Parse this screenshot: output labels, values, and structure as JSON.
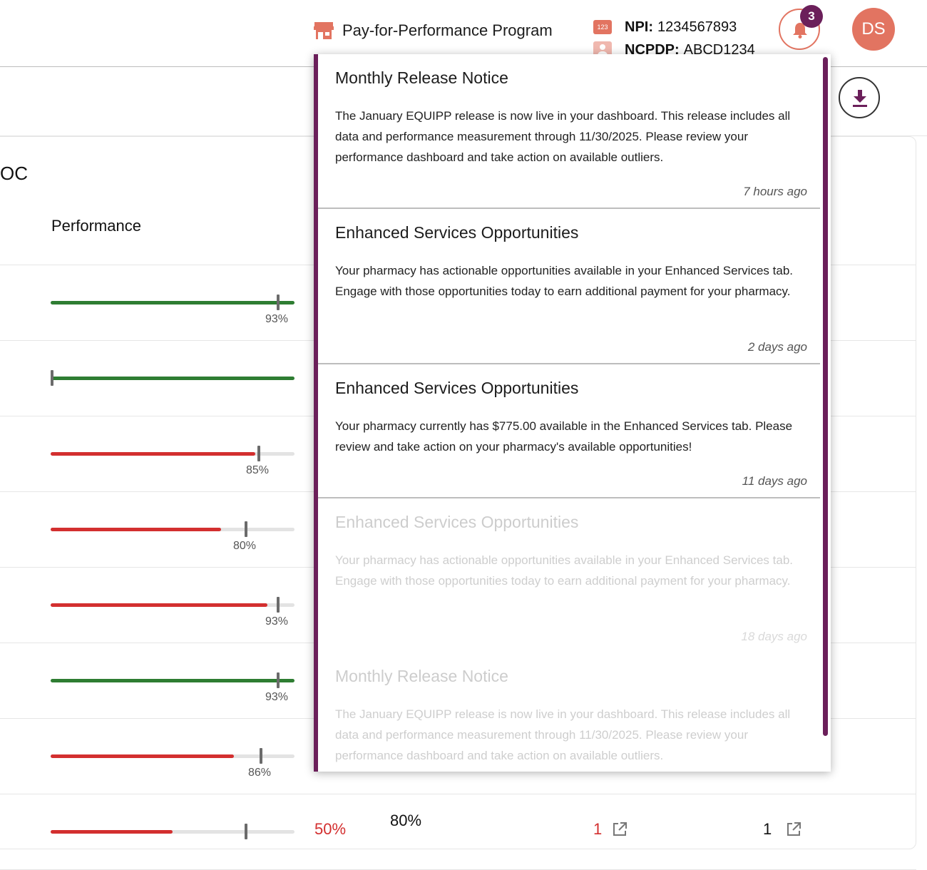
{
  "header": {
    "program_title": "Pay-for-Performance Program",
    "npi_label": "NPI:",
    "npi_value": "1234567893",
    "ncpdp_label": "NCPDP:",
    "ncpdp_value": "ABCD1234",
    "id_badge_text": "123",
    "notification_count": "3",
    "avatar_initials": "DS"
  },
  "page": {
    "card_title_fragment": "OC",
    "performance_header": "Performance"
  },
  "performance_rows": [
    {
      "fill_pct": 100,
      "color": "green",
      "marker_label": "93%",
      "show_label": true
    },
    {
      "fill_pct": 100,
      "color": "green",
      "marker_label": "",
      "show_label": false
    },
    {
      "fill_pct": 84,
      "color": "red",
      "marker_label": "85%",
      "show_label": true
    },
    {
      "fill_pct": 70,
      "color": "red",
      "marker_label": "80%",
      "show_label": true
    },
    {
      "fill_pct": 89,
      "color": "red",
      "marker_label": "93%",
      "show_label": true
    },
    {
      "fill_pct": 100,
      "color": "green",
      "marker_label": "93%",
      "show_label": true
    },
    {
      "fill_pct": 75,
      "color": "red",
      "marker_label": "86%",
      "show_label": true
    },
    {
      "fill_pct": 50,
      "color": "red",
      "marker_label": "",
      "show_label": false
    }
  ],
  "bottom_row": {
    "value_red": "50%",
    "value_target": "80%",
    "count_a": "1",
    "count_b": "1"
  },
  "notifications": [
    {
      "title": "Monthly Release Notice",
      "body": "The January EQUIPP release is now live in your dashboard. This release includes all data and performance measurement through 11/30/2025. Please review your performance dashboard and take action on available outliers.",
      "time": "7 hours ago"
    },
    {
      "title": "Enhanced Services Opportunities",
      "body": "Your pharmacy has actionable opportunities available in your Enhanced Services tab. Engage with those opportunities today to earn additional payment for your pharmacy.",
      "time": "2 days ago"
    },
    {
      "title": "Enhanced Services Opportunities",
      "body": "Your pharmacy currently has $775.00 available in the Enhanced Services tab. Please review and take action on your pharmacy's available opportunities!",
      "time": "11 days ago"
    },
    {
      "title": "Enhanced Services Opportunities",
      "body": "Your pharmacy has actionable opportunities available in your Enhanced Services tab. Engage with those opportunities today to earn additional payment for your pharmacy.",
      "time": "18 days ago"
    },
    {
      "title": "Monthly Release Notice",
      "body": "The January EQUIPP release is now live in your dashboard. This release includes all data and performance measurement through 11/30/2025. Please review your performance dashboard and take action on available outliers.",
      "time": ""
    }
  ],
  "colors": {
    "accent": "#e27461",
    "brand_purple": "#6b1f5a",
    "bar_green": "#2e7d32",
    "bar_red": "#d32f2f"
  },
  "icons": {
    "store": "storefront-icon",
    "id_badge": "id-badge-icon",
    "person": "person-card-icon",
    "bell": "bell-icon",
    "download": "download-icon",
    "external": "external-link-icon"
  }
}
